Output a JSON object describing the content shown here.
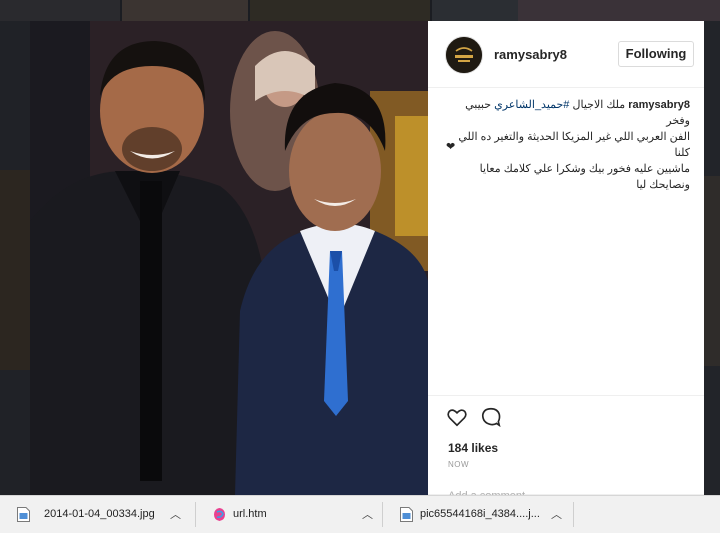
{
  "post": {
    "username": "ramysabry8",
    "follow_label": "Following",
    "caption": {
      "username": "ramysabry8",
      "line_1_prefix": "ملك الاجيال",
      "hashtag": "#حميد_الشاعري",
      "line_1_suffix": "حبيبي وفخر",
      "line_2": "الفن العربي اللي غير المزيكا الحديثة والتغير ده اللي كلنا",
      "line_3": "ماشيين عليه فخور بيك وشكرا علي كلامك معايا ونصايحك ليا",
      "heart": "❤"
    },
    "likes": "184 likes",
    "timestamp": "NOW",
    "comment_placeholder": "Add a comment...",
    "more": "···"
  },
  "downloads": [
    {
      "name": "2014-01-04_00334.jpg",
      "icon": "image-file-icon"
    },
    {
      "name": "url.htm",
      "icon": "browser-file-icon"
    },
    {
      "name": "pic65544168i_4384....j...",
      "icon": "image-file-icon"
    }
  ],
  "colors": {
    "background": "#1b1d22",
    "panel": "#ffffff",
    "hashtag": "#003569",
    "download_bar": "#f1f1f1"
  }
}
